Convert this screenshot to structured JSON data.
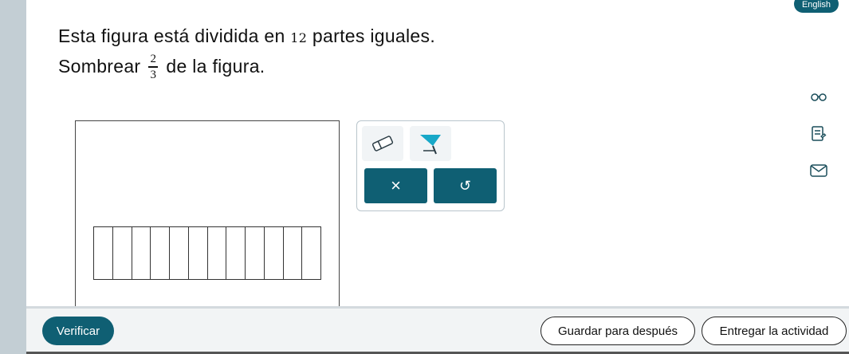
{
  "language_button": "English",
  "question": {
    "line1_before": "Esta figura está dividida en ",
    "line1_number": "12",
    "line1_after": " partes iguales.",
    "line2_before": "Sombrear",
    "fraction_numerator": "2",
    "fraction_denominator": "3",
    "line2_after": "de la figura."
  },
  "side_tools": [
    "glasses-icon",
    "notes-icon",
    "mail-icon"
  ],
  "toolbox": {
    "tools": [
      "eraser-icon",
      "fill-paint-icon"
    ],
    "clear_label": "×",
    "undo_label": "↺"
  },
  "grid": {
    "parts": 12,
    "shaded": 0
  },
  "footer": {
    "verify_label": "Verificar",
    "save_label": "Guardar para después",
    "submit_label": "Entregar la actividad"
  },
  "colors": {
    "accent": "#0f5f73",
    "fill_tool": "#18a8c8",
    "rail": "#c3ced4"
  }
}
